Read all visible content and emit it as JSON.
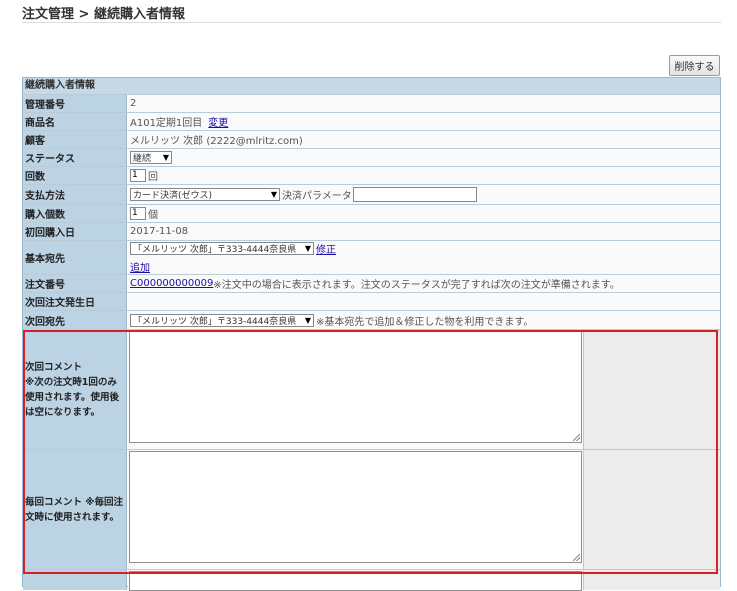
{
  "header": {
    "title": "注文管理 > 継続購入者情報"
  },
  "actions": {
    "delete_label": "削除する"
  },
  "section": {
    "title": "継続購入者情報"
  },
  "fields": {
    "admin_no": {
      "label": "管理番号",
      "value": "2"
    },
    "product": {
      "label": "商品名",
      "value": "A101定期1回目",
      "link": "変更"
    },
    "customer": {
      "label": "顧客",
      "value": "メルリッツ 次郎 (2222@mlritz.com)"
    },
    "status": {
      "label": "ステータス",
      "selected": "継続"
    },
    "count": {
      "label": "回数",
      "value": "1",
      "unit": "回"
    },
    "payment": {
      "label": "支払方法",
      "selected": "カード決済(ゼウス)",
      "param_label": "決済パラメータ",
      "param_value": ""
    },
    "quantity": {
      "label": "購入個数",
      "value": "1",
      "unit": "個"
    },
    "first_date": {
      "label": "初回購入日",
      "value": "2017-11-08"
    },
    "base_address": {
      "label": "基本宛先",
      "selected": "「メルリッツ 次郎」〒333-4444奈良県",
      "edit_link": "修正",
      "add_link": "追加"
    },
    "order_no": {
      "label": "注文番号",
      "link": "C000000000009",
      "note": "※注文中の場合に表示されます。注文のステータスが完了すれば次の注文が準備されます。"
    },
    "next_order_date": {
      "label": "次回注文発生日",
      "value": ""
    },
    "next_address": {
      "label": "次回宛先",
      "selected": "「メルリッツ 次郎」〒333-4444奈良県",
      "note": "※基本宛先で追加＆修正した物を利用できます。"
    }
  },
  "comments": {
    "next": {
      "label": "次回コメント\n※次の注文時1回のみ使用されます。使用後は空になります。",
      "value": ""
    },
    "every": {
      "label": "毎回コメント ※毎回注文時に使用されます。",
      "value": ""
    }
  },
  "colors": {
    "highlight": "#d6202a",
    "label_bg": "#bcd3e4",
    "header_bg": "#c5d9e8"
  }
}
